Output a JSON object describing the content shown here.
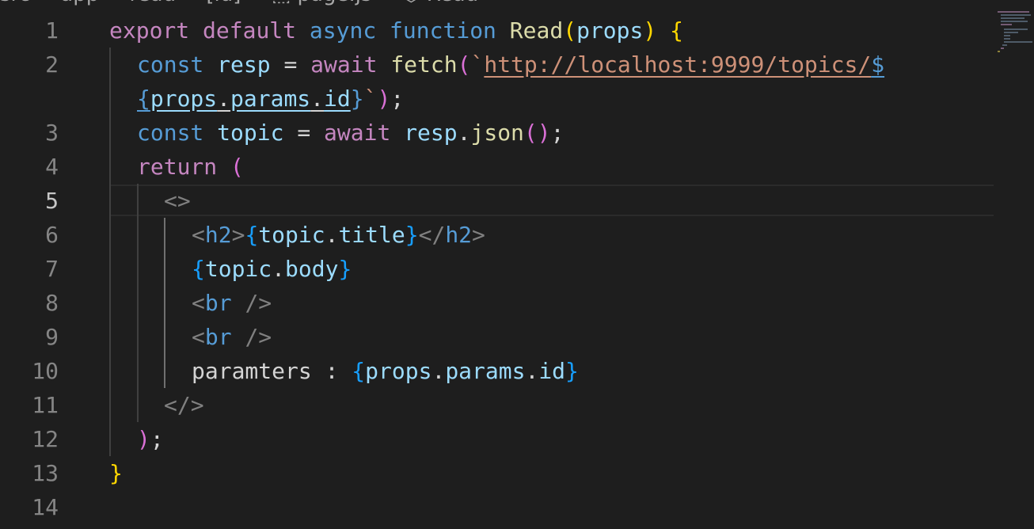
{
  "breadcrumb": {
    "text": "src > app > read > [id] > ⬚ page.js > ⬡ Read"
  },
  "editor": {
    "active_line": 5,
    "line_numbers": [
      "1",
      "2",
      "",
      "3",
      "4",
      "5",
      "6",
      "7",
      "8",
      "9",
      "10",
      "11",
      "12",
      "13",
      "14"
    ],
    "tokens": {
      "export": "export",
      "default": "default",
      "async": "async",
      "function": "function",
      "read_fn": "Read",
      "props": "props",
      "const": "const",
      "resp": "resp",
      "await": "await",
      "fetch": "fetch",
      "url": "http://localhost:9999/topics/",
      "dollar": "$",
      "params": "params",
      "id": "id",
      "topic": "topic",
      "json": "json",
      "return": "return",
      "h2": "h2",
      "title": "title",
      "body": "body",
      "br": "br",
      "paramters_label": "paramters : "
    }
  },
  "colors": {
    "background": "#1e1e1e",
    "keyword": "#c586c0",
    "storage": "#569cd6",
    "function": "#dcdcaa",
    "variable": "#9cdcfe",
    "string": "#ce9178",
    "bracket_gold": "#ffd700",
    "bracket_orchid": "#da70d6",
    "bracket_blue": "#179fff"
  }
}
